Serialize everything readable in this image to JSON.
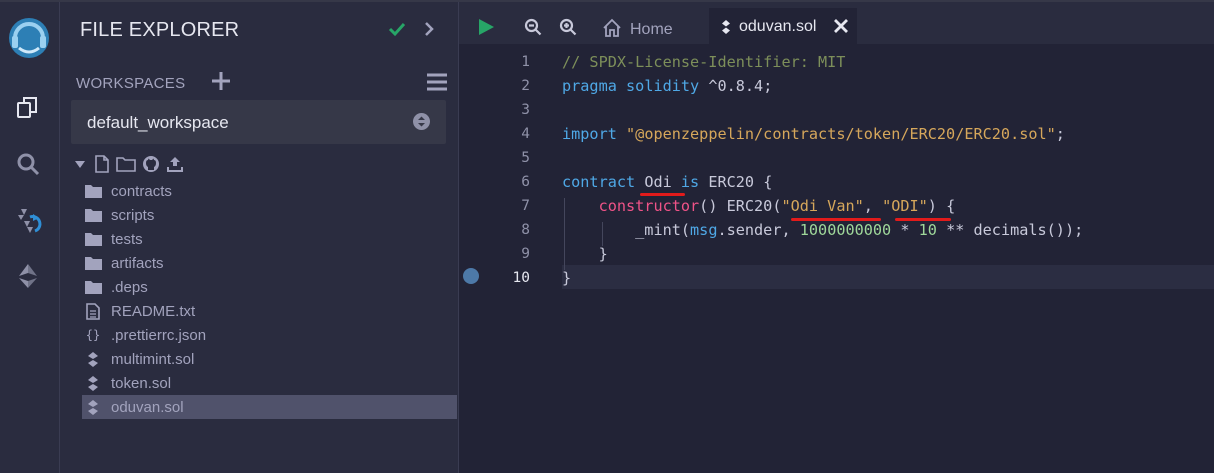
{
  "explorer": {
    "title": "FILE EXPLORER",
    "workspaces_label": "WORKSPACES",
    "workspace_selected": "default_workspace",
    "files": [
      {
        "name": "contracts",
        "icon": "folder-icon"
      },
      {
        "name": "scripts",
        "icon": "folder-icon"
      },
      {
        "name": "tests",
        "icon": "folder-icon"
      },
      {
        "name": "artifacts",
        "icon": "folder-icon"
      },
      {
        "name": ".deps",
        "icon": "folder-icon"
      },
      {
        "name": "README.txt",
        "icon": "text-file-icon"
      },
      {
        "name": ".prettierrc.json",
        "icon": "json-file-icon"
      },
      {
        "name": "multimint.sol",
        "icon": "solidity-file-icon"
      },
      {
        "name": "token.sol",
        "icon": "solidity-file-icon"
      },
      {
        "name": "oduvan.sol",
        "icon": "solidity-file-icon",
        "selected": true
      }
    ]
  },
  "tabs": {
    "home": "Home",
    "active": "oduvan.sol"
  },
  "editor": {
    "line_numbers": [
      "1",
      "2",
      "3",
      "4",
      "5",
      "6",
      "7",
      "8",
      "9",
      "10"
    ],
    "current_line": "10",
    "code": {
      "l1": "// SPDX-License-Identifier: MIT",
      "l2_kw1": "pragma",
      "l2_kw2": "solidity",
      "l2_rest": " ^0.8.4;",
      "l4_kw": "import",
      "l4_str": "\"@openzeppelin/contracts/token/ERC20/ERC20.sol\"",
      "l4_end": ";",
      "l6_kw": "contract",
      "l6_name": "Odi",
      "l6_is": "is",
      "l6_rest": " ERC20 {",
      "l7_fn": "constructor",
      "l7_a": "() ERC20(",
      "l7_s1": "\"Odi Van\"",
      "l7_b": ", ",
      "l7_s2": "\"ODI\"",
      "l7_c": ") {",
      "l8_a": "_mint(",
      "l8_msg": "msg",
      "l8_b": ".sender, ",
      "l8_num1": "1000000000",
      "l8_c": " * ",
      "l8_num2": "10",
      "l8_d": " ** decimals());",
      "l9": "}",
      "l10": "}"
    }
  },
  "colors": {
    "panel": "#2a2c3f",
    "editor_bg": "#222336",
    "accent_green": "#27a567",
    "annotation_red": "#e21b1b"
  }
}
